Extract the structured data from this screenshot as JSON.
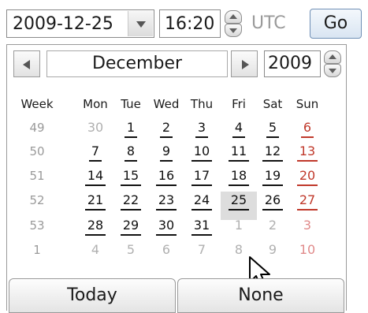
{
  "date_field": {
    "value": "2009-12-25",
    "dropdown_icon": "chevron-down-icon"
  },
  "time_field": {
    "value": "16:20",
    "spinner_icons": [
      "arrow-up-icon",
      "arrow-down-icon"
    ]
  },
  "timezone": "UTC",
  "go_label": "Go",
  "calendar": {
    "month": "December",
    "year": "2009",
    "prev_icon": "arrow-left-icon",
    "next_icon": "arrow-right-icon",
    "week_header": "Week",
    "weekday_headers": [
      "Mon",
      "Tue",
      "Wed",
      "Thu",
      "Fri",
      "Sat",
      "Sun"
    ],
    "weeks": [
      {
        "week": "49",
        "days": [
          "30",
          "1",
          "2",
          "3",
          "4",
          "5",
          "6"
        ]
      },
      {
        "week": "50",
        "days": [
          "7",
          "8",
          "9",
          "10",
          "11",
          "12",
          "13"
        ]
      },
      {
        "week": "51",
        "days": [
          "14",
          "15",
          "16",
          "17",
          "18",
          "19",
          "20"
        ]
      },
      {
        "week": "52",
        "days": [
          "21",
          "22",
          "23",
          "24",
          "25",
          "26",
          "27"
        ]
      },
      {
        "week": "53",
        "days": [
          "28",
          "29",
          "30",
          "31",
          "1",
          "2",
          "3"
        ]
      },
      {
        "week": "1",
        "days": [
          "4",
          "5",
          "6",
          "7",
          "8",
          "9",
          "10"
        ]
      }
    ],
    "hovered_day": "25",
    "today_label": "Today",
    "none_label": "None"
  },
  "colors": {
    "sunday": "#c0392b",
    "muted": "#9a9a9a",
    "hover": "#dddddd",
    "go_border": "#6f8fb5"
  }
}
